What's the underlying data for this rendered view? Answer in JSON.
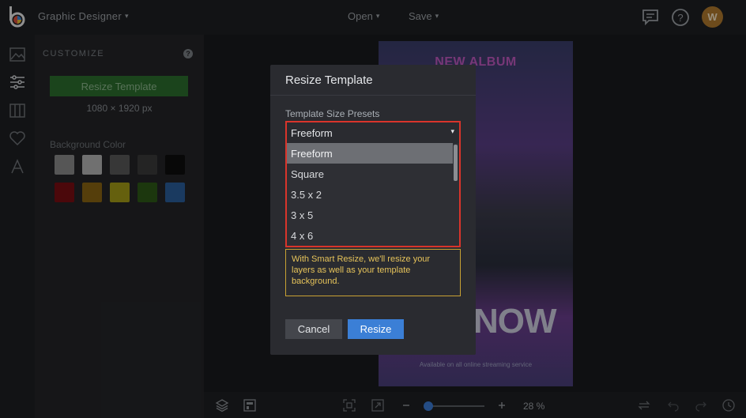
{
  "header": {
    "app_title": "Graphic Designer",
    "open_label": "Open",
    "save_label": "Save",
    "avatar_initial": "W"
  },
  "sidebar": {
    "section_title": "CUSTOMIZE",
    "resize_button": "Resize Template",
    "dimensions": "1080 × 1920 px",
    "background_label": "Background Color",
    "swatches": [
      "#8c8c8c",
      "#b5b5b5",
      "#5a5a5a",
      "#3a3a3a",
      "#0d0d0d",
      "#7a0d12",
      "#8a6412",
      "#a39b18",
      "#2e5a18",
      "#2a5e9c"
    ]
  },
  "poster": {
    "title": "NEW ALBUM",
    "big_text": "NOW",
    "footer": "Available on all online streaming service"
  },
  "bottombar": {
    "zoom_value": "28 %"
  },
  "modal": {
    "title": "Resize Template",
    "presets_label": "Template Size Presets",
    "selected": "Freeform",
    "options": [
      "Freeform",
      "Square",
      "3.5 x 2",
      "3 x 5",
      "4 x 6"
    ],
    "info_text": "With Smart Resize, we'll resize your layers as well as your template background.",
    "cancel_label": "Cancel",
    "resize_label": "Resize"
  },
  "colors": {
    "accent_blue": "#3b7fd6",
    "highlight_red": "#d9342b",
    "info_yellow": "#e6c35a",
    "resize_green": "#2c6e2e"
  }
}
